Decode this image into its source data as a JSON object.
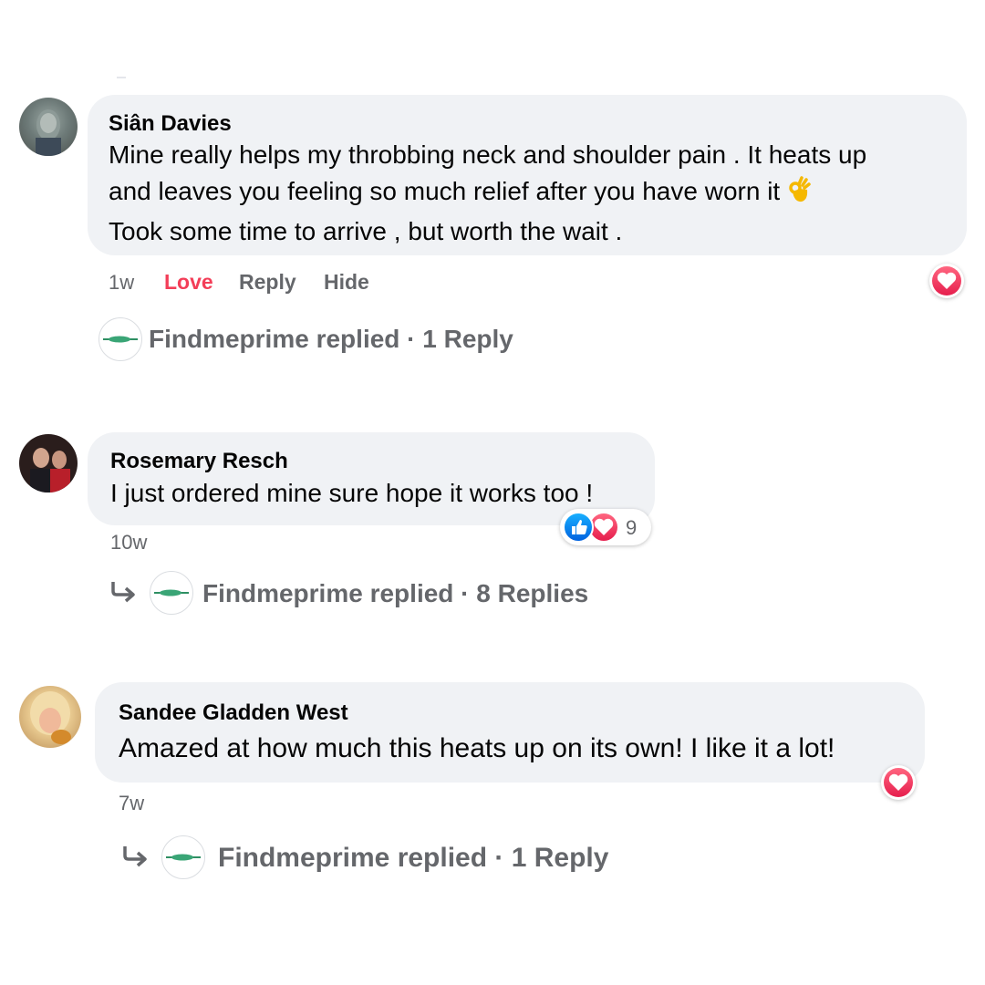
{
  "colors": {
    "bubble": "#f0f2f5",
    "secondary_text": "#65676b",
    "love": "#f33e58",
    "like_blue": "#1877f2"
  },
  "comments": [
    {
      "author": "Siân Davies",
      "lines": [
        "Mine really helps my throbbing neck and shoulder pain . It heats up",
        "and leaves you feeling so much relief after you have worn it",
        "Took some time to arrive , but worth the wait ."
      ],
      "emoji": "ok-hand-emoji",
      "time": "1w",
      "actions": {
        "love": "Love",
        "reply": "Reply",
        "hide": "Hide"
      },
      "reaction_icon": "heart-icon",
      "reply_summary": "Findmeprime replied · 1 Reply"
    },
    {
      "author": "Rosemary Resch",
      "lines": [
        "I just ordered mine sure hope it works too !"
      ],
      "time": "10w",
      "reactions": {
        "icons": [
          "like-icon",
          "heart-icon"
        ],
        "count": "9"
      },
      "reply_summary": "Findmeprime replied · 8 Replies"
    },
    {
      "author": "Sandee Gladden West",
      "lines": [
        "Amazed at how much this heats up on its own! I like it a lot!"
      ],
      "time": "7w",
      "reaction_icon": "heart-icon",
      "reply_summary": "Findmeprime replied · 1 Reply"
    }
  ]
}
